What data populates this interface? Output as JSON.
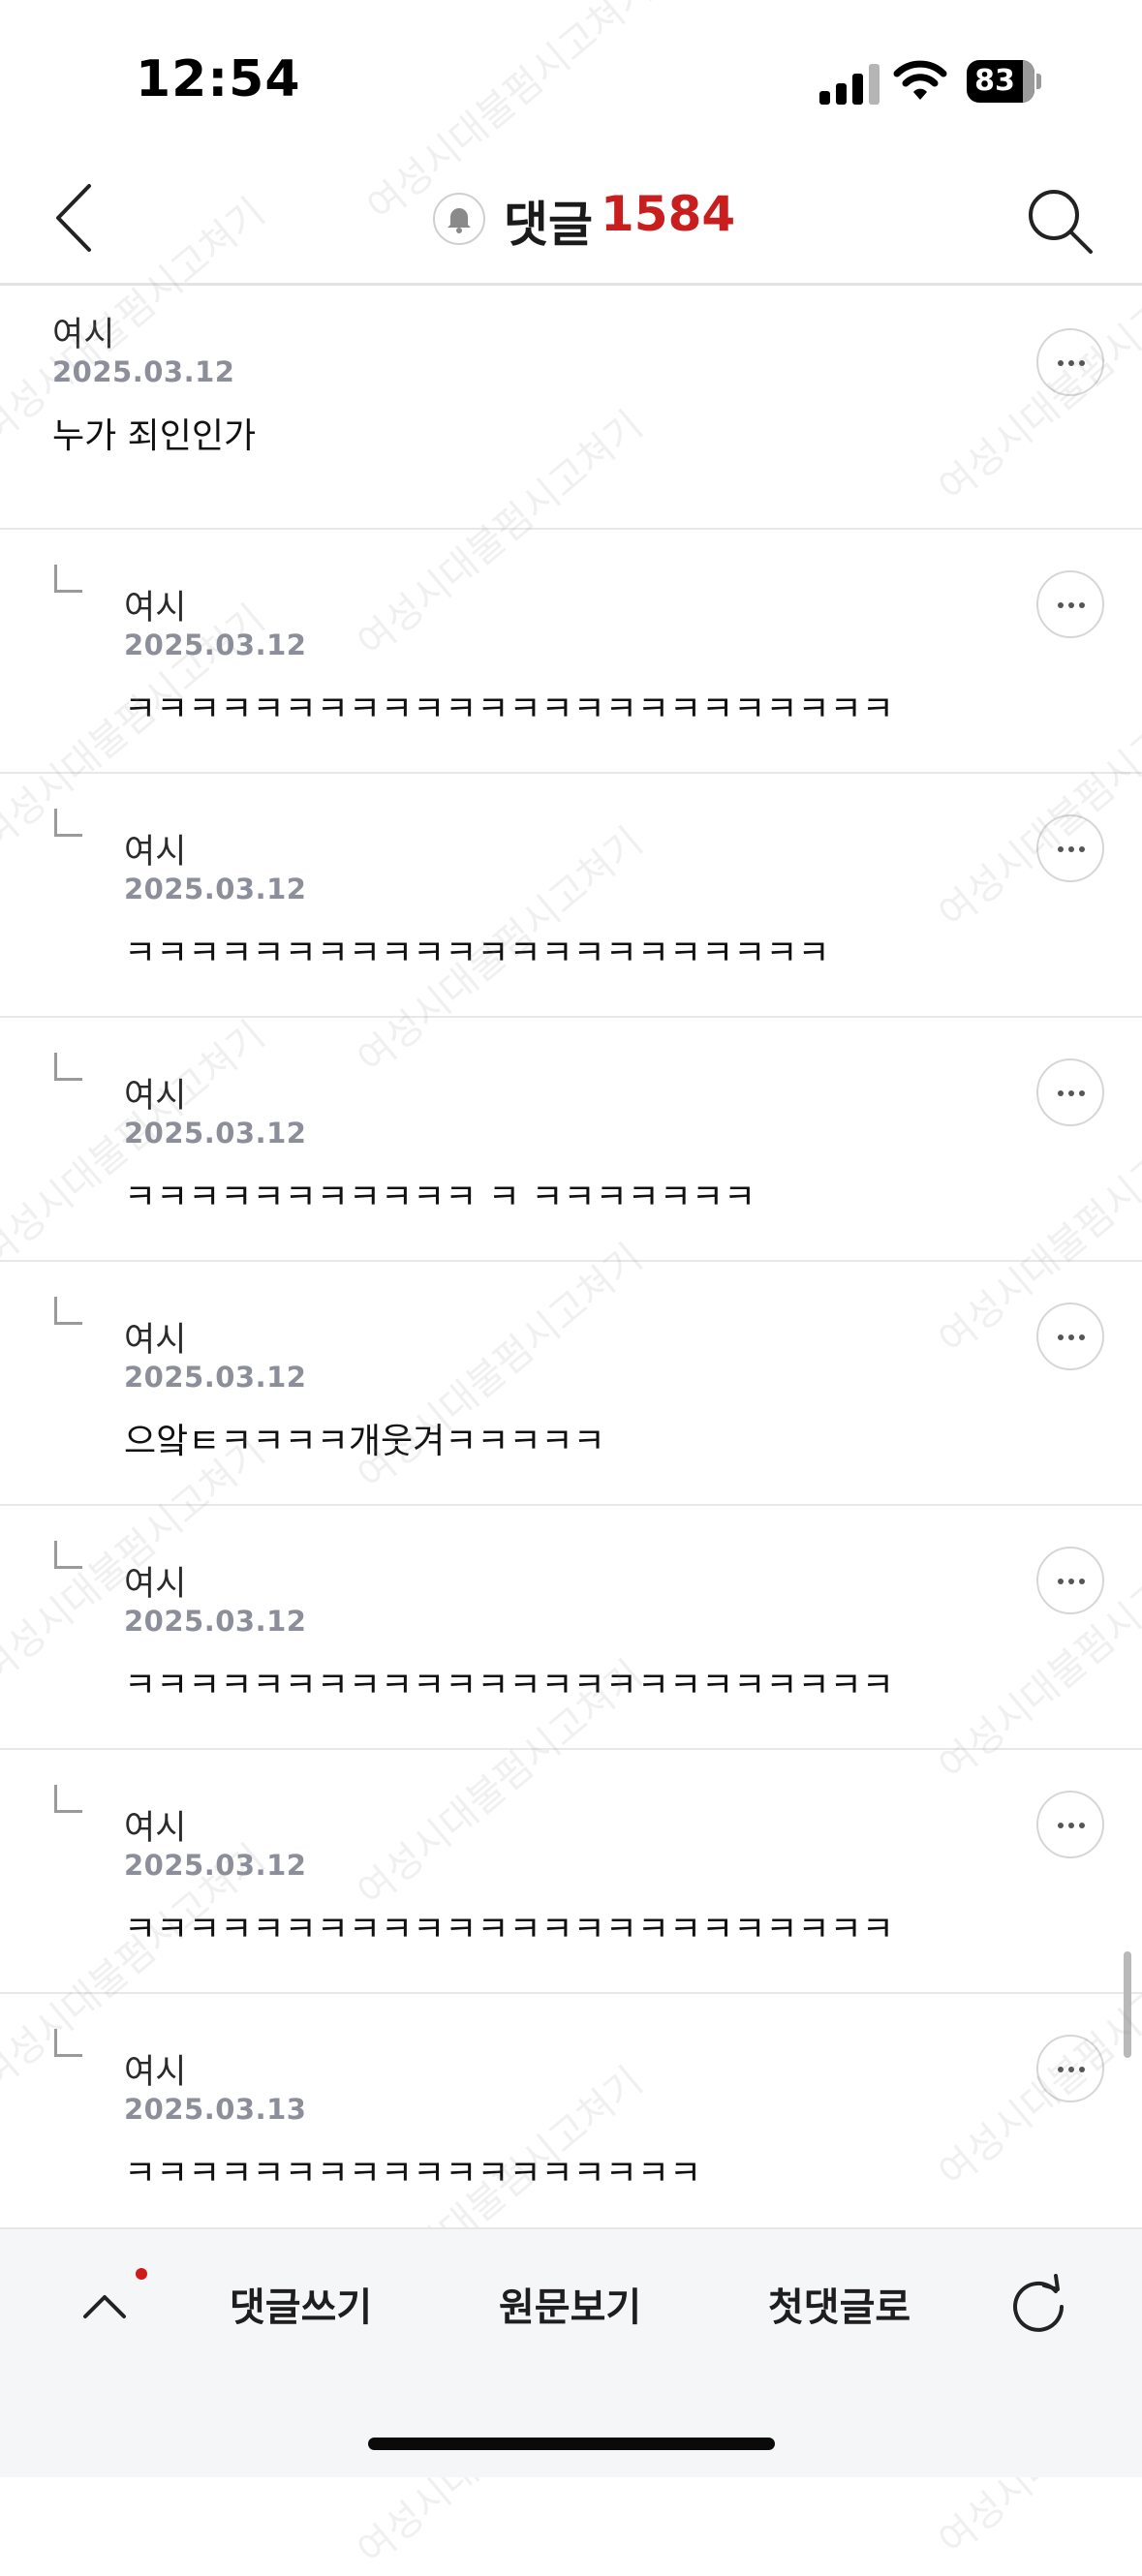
{
  "status_bar": {
    "time": "12:54",
    "battery": "83",
    "battery_level": 0.83
  },
  "header": {
    "title": "댓글",
    "count": "1584"
  },
  "comments": [
    {
      "author": "여시",
      "date": "2025.03.12",
      "text": "누가 죄인인가",
      "is_reply": false
    },
    {
      "author": "여시",
      "date": "2025.03.12",
      "text": "ㅋㅋㅋㅋㅋㅋㅋㅋㅋㅋㅋㅋㅋㅋㅋㅋㅋㅋㅋㅋㅋㅋㅋㅋ",
      "is_reply": true
    },
    {
      "author": "여시",
      "date": "2025.03.12",
      "text": "ㅋㅋㅋㅋㅋㅋㅋㅋㅋㅋㅋㅋㅋㅋㅋㅋㅋㅋㅋㅋㅋㅋ",
      "is_reply": true
    },
    {
      "author": "여시",
      "date": "2025.03.12",
      "text": "ㅋㅋㅋㅋㅋㅋㅋㅋㅋㅋㅋ ㅋ ㅋㅋㅋㅋㅋㅋㅋ",
      "is_reply": true
    },
    {
      "author": "여시",
      "date": "2025.03.12",
      "text": "으앜ㅌㅋㅋㅋㅋ개웃겨ㅋㅋㅋㅋㅋ",
      "is_reply": true
    },
    {
      "author": "여시",
      "date": "2025.03.12",
      "text": "ㅋㅋㅋㅋㅋㅋㅋㅋㅋㅋㅋㅋㅋㅋㅋㅋㅋㅋㅋㅋㅋㅋㅋㅋ",
      "is_reply": true
    },
    {
      "author": "여시",
      "date": "2025.03.12",
      "text": "ㅋㅋㅋㅋㅋㅋㅋㅋㅋㅋㅋㅋㅋㅋㅋㅋㅋㅋㅋㅋㅋㅋㅋㅋ",
      "is_reply": true
    },
    {
      "author": "여시",
      "date": "2025.03.13",
      "text": "ㅋㅋㅋㅋㅋㅋㅋㅋㅋㅋㅋㅋㅋㅋㅋㅋㅋㅋ",
      "is_reply": true
    }
  ],
  "watermark": "여성시대불펌시고쳐기",
  "toolbar": {
    "write_comment": "댓글쓰기",
    "view_original": "원문보기",
    "first_comment": "첫댓글로"
  },
  "icons": {
    "back": "back-chevron-icon",
    "bell": "bell-icon",
    "search": "search-icon",
    "more": "more-dots-icon",
    "up": "chevron-up-icon",
    "refresh": "refresh-icon"
  },
  "colors": {
    "accent": "#c81e1e",
    "muted": "#8c8f99"
  }
}
